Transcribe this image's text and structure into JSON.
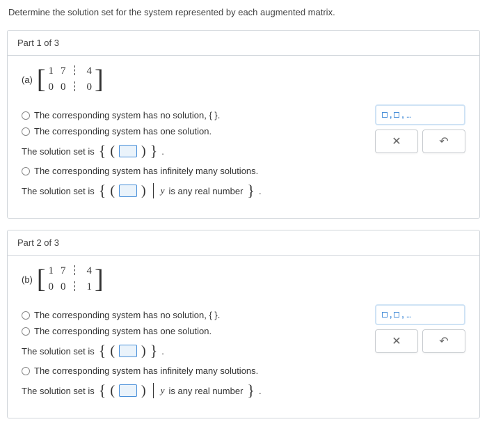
{
  "prompt": "Determine the solution set for the system represented by each augmented matrix.",
  "parts": [
    {
      "header": "Part 1 of 3",
      "label": "(a)",
      "matrix": {
        "r1c1": "1",
        "r1c2": "7",
        "r1c3": "4",
        "r2c1": "0",
        "r2c2": "0",
        "r2c3": "0"
      },
      "opt1": "The corresponding system has no solution, { }.",
      "opt2": "The corresponding system has one solution.",
      "sol_prefix": "The solution set is",
      "opt3": "The corresponding system has infinitely many solutions.",
      "sol2_suffix": " is any real number",
      "yvar": "y"
    },
    {
      "header": "Part 2 of 3",
      "label": "(b)",
      "matrix": {
        "r1c1": "1",
        "r1c2": "7",
        "r1c3": "4",
        "r2c1": "0",
        "r2c2": "0",
        "r2c3": "1"
      },
      "opt1": "The corresponding system has no solution, { }.",
      "opt2": "The corresponding system has one solution.",
      "sol_prefix": "The solution set is",
      "opt3": "The corresponding system has infinitely many solutions.",
      "sol2_suffix": " is any real number",
      "yvar": "y"
    }
  ],
  "tool": {
    "clear_title": "Clear",
    "reset_title": "Reset"
  }
}
